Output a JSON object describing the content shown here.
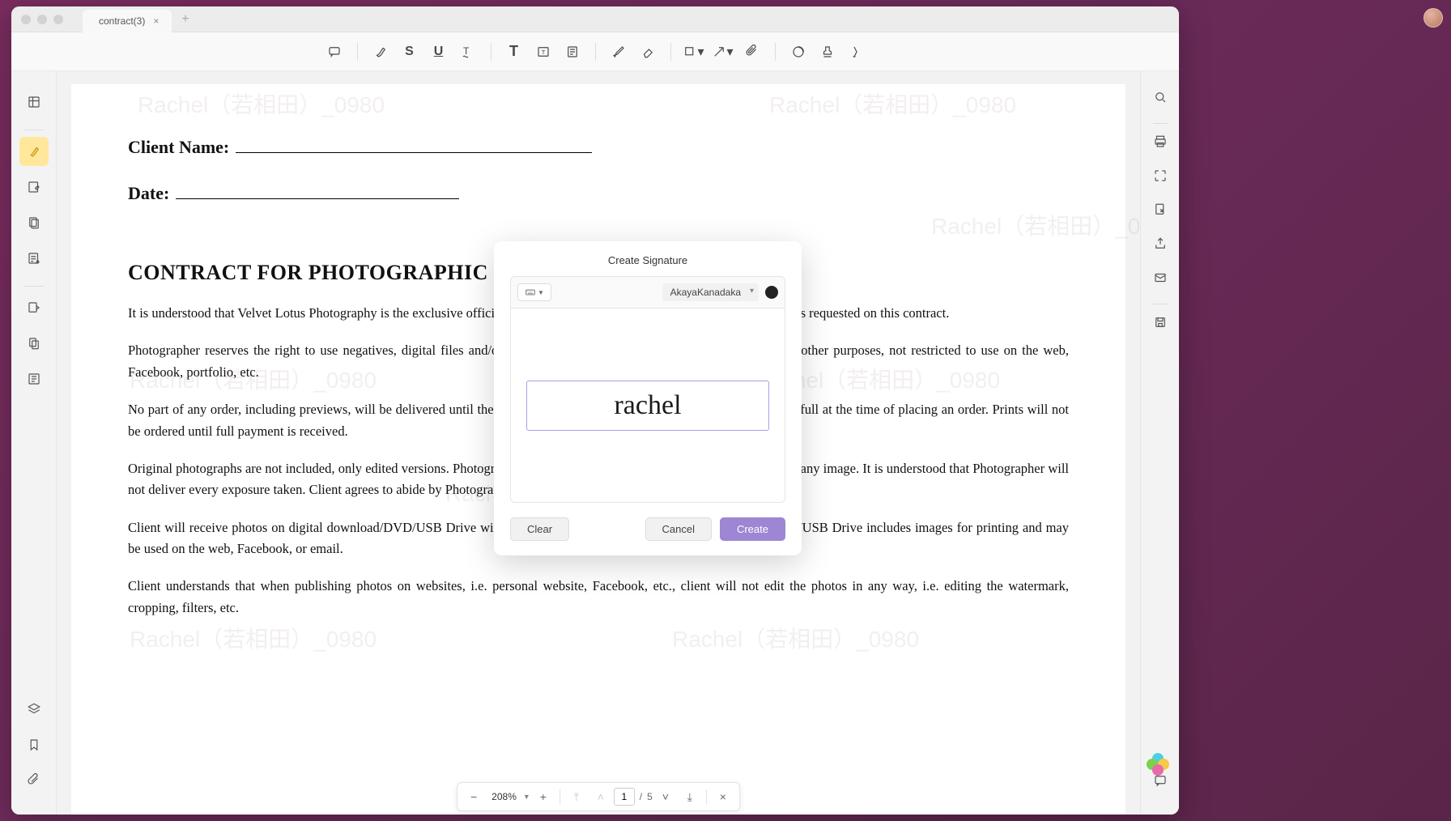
{
  "tab": {
    "title": "contract(3)"
  },
  "document": {
    "client_label": "Client Name:",
    "date_label": "Date:",
    "heading": "CONTRACT FOR PHOTOGRAPHIC SERVICES",
    "p1": "It is understood that Velvet Lotus Photography is the exclusive official photographer retained to perform photographic services requested on this contract.",
    "p2": "Photographer reserves the right to use negatives, digital files and/or reproductions for advertising, display, publication or other purposes, not restricted to use on the web, Facebook, portfolio, etc.",
    "p3": "No part of any order, including previews, will be delivered until the balance is paid in full. Payment for prints is required in full at the time of placing an order. Prints will not be ordered until full payment is received.",
    "p4": "Original photographs are not included, only edited versions. Photographer reserves the right to edit the photographs and omit any image. It is understood that Photographer will not deliver every exposure taken. Client agrees to abide by Photographer's editing decisions.",
    "p5": "Client will receive photos on digital download/DVD/USB Drive with print release for personal use. Digital download/DVD/USB Drive includes images for printing and may be used on the web, Facebook, or email.",
    "p6": "Client understands that when publishing photos on websites, i.e. personal website, Facebook, etc., client will not edit the photos in any way, i.e. editing the watermark, cropping, filters, etc."
  },
  "modal": {
    "title": "Create Signature",
    "font": "AkayaKanadaka",
    "input_value": "rachel",
    "clear": "Clear",
    "cancel": "Cancel",
    "create": "Create"
  },
  "page_nav": {
    "zoom": "208%",
    "current": "1",
    "sep": "/",
    "total": "5"
  }
}
